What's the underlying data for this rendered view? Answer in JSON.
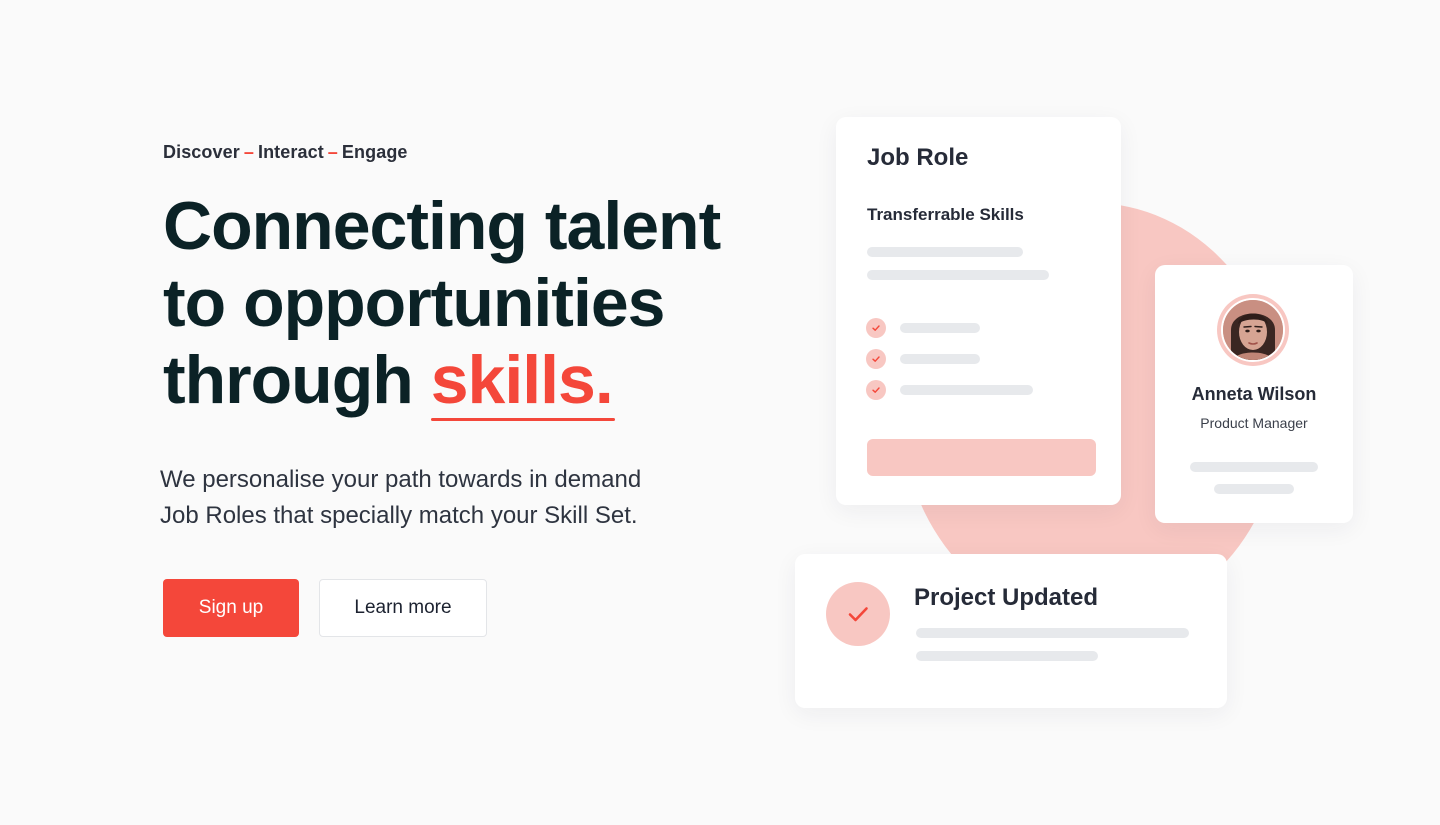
{
  "hero": {
    "tagline": {
      "word1": "Discover",
      "word2": "Interact",
      "word3": "Engage",
      "separator": "–"
    },
    "headline": {
      "line1": "Connecting talent",
      "line2": "to opportunities",
      "line3_prefix": "through ",
      "accent": "skills."
    },
    "subtext": {
      "line1": "We personalise your path towards in demand",
      "line2": "Job Roles that specially match your Skill Set."
    },
    "buttons": {
      "primary": "Sign up",
      "secondary": "Learn more"
    }
  },
  "illustration": {
    "job_card": {
      "title": "Job Role",
      "subtitle": "Transferrable Skills",
      "checklist_count_icons": [
        "check-icon",
        "check-icon",
        "check-icon"
      ]
    },
    "profile_card": {
      "name": "Anneta Wilson",
      "role": "Product Manager",
      "avatar_icon": "avatar-portrait"
    },
    "project_card": {
      "title": "Project Updated",
      "status_icon": "check-icon"
    }
  },
  "colors": {
    "accent": "#f4473a",
    "accent_soft": "#f8c7c2",
    "heading": "#0b2226",
    "background": "#fafafa",
    "placeholder_bar": "#e7e9ec"
  }
}
